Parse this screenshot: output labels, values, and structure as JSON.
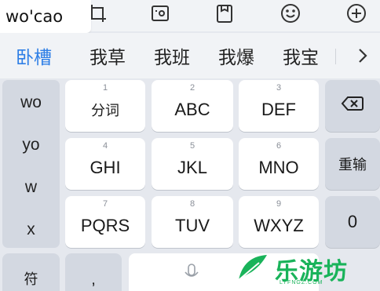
{
  "toolbar": {
    "icons": [
      "crop-icon",
      "video-icon",
      "clipboard-icon",
      "emoji-icon",
      "add-icon"
    ]
  },
  "pinyin": {
    "text": "wo'cao"
  },
  "candidates": {
    "items": [
      "卧槽",
      "我草",
      "我班",
      "我爆",
      "我宝"
    ],
    "accent_color": "#2f7fe6"
  },
  "side_panel": {
    "items": [
      "wo",
      "yo",
      "w",
      "x"
    ]
  },
  "keys": {
    "row1": [
      {
        "num": "1",
        "label": "分词"
      },
      {
        "num": "2",
        "label": "ABC"
      },
      {
        "num": "3",
        "label": "DEF"
      }
    ],
    "row2": [
      {
        "num": "4",
        "label": "GHI"
      },
      {
        "num": "5",
        "label": "JKL"
      },
      {
        "num": "6",
        "label": "MNO"
      }
    ],
    "row3": [
      {
        "num": "7",
        "label": "PQRS"
      },
      {
        "num": "8",
        "label": "TUV"
      },
      {
        "num": "9",
        "label": "WXYZ"
      }
    ],
    "reenter_label": "重输",
    "zero_label": "0",
    "symbol_label": "符",
    "comma_label": ","
  },
  "watermark": {
    "text": "乐游坊",
    "sub": "LYFNGZ.COM",
    "color": "#19b35a"
  }
}
